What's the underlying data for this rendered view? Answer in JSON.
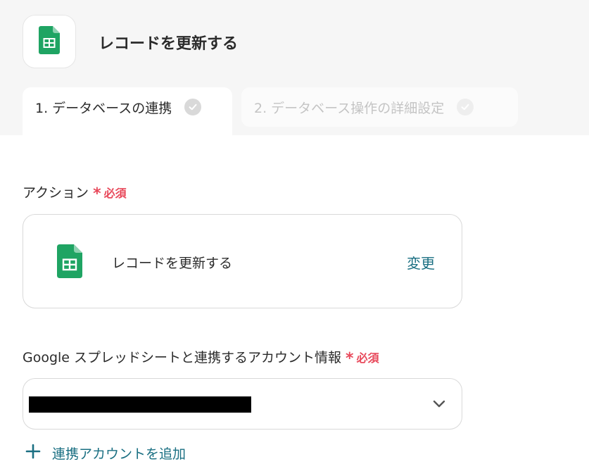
{
  "header": {
    "title": "レコードを更新する",
    "app_icon": "google-sheets-icon"
  },
  "tabs": [
    {
      "label": "1. データベースの連携",
      "active": true,
      "icon": "check-circle-icon"
    },
    {
      "label": "2. データベース操作の詳細設定",
      "active": false,
      "icon": "check-circle-icon"
    }
  ],
  "action_section": {
    "label": "アクション",
    "required_label": "必須",
    "card": {
      "icon": "google-sheets-icon",
      "name": "レコードを更新する",
      "change_label": "変更"
    }
  },
  "account_section": {
    "label": "Google スプレッドシートと連携するアカウント情報",
    "required_label": "必須",
    "select": {
      "icon": "chevron-down-icon"
    },
    "add_label": "連携アカウントを追加",
    "add_icon": "plus-icon"
  },
  "colors": {
    "accent": "#1a6f82",
    "required": "#e8495b",
    "sheets_green": "#1fa463"
  }
}
